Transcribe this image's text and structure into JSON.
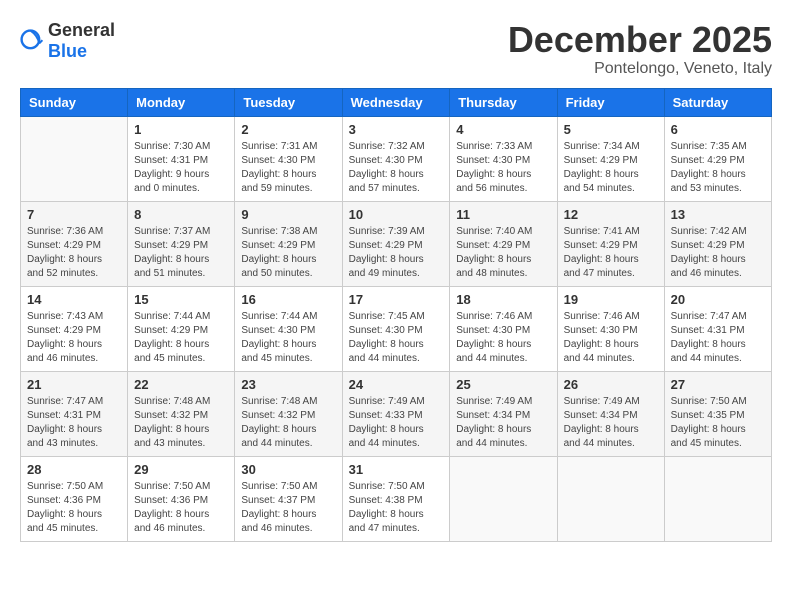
{
  "header": {
    "logo_general": "General",
    "logo_blue": "Blue",
    "month": "December 2025",
    "location": "Pontelongo, Veneto, Italy"
  },
  "weekdays": [
    "Sunday",
    "Monday",
    "Tuesday",
    "Wednesday",
    "Thursday",
    "Friday",
    "Saturday"
  ],
  "weeks": [
    [
      {
        "day": "",
        "info": ""
      },
      {
        "day": "1",
        "info": "Sunrise: 7:30 AM\nSunset: 4:31 PM\nDaylight: 9 hours\nand 0 minutes."
      },
      {
        "day": "2",
        "info": "Sunrise: 7:31 AM\nSunset: 4:30 PM\nDaylight: 8 hours\nand 59 minutes."
      },
      {
        "day": "3",
        "info": "Sunrise: 7:32 AM\nSunset: 4:30 PM\nDaylight: 8 hours\nand 57 minutes."
      },
      {
        "day": "4",
        "info": "Sunrise: 7:33 AM\nSunset: 4:30 PM\nDaylight: 8 hours\nand 56 minutes."
      },
      {
        "day": "5",
        "info": "Sunrise: 7:34 AM\nSunset: 4:29 PM\nDaylight: 8 hours\nand 54 minutes."
      },
      {
        "day": "6",
        "info": "Sunrise: 7:35 AM\nSunset: 4:29 PM\nDaylight: 8 hours\nand 53 minutes."
      }
    ],
    [
      {
        "day": "7",
        "info": "Sunrise: 7:36 AM\nSunset: 4:29 PM\nDaylight: 8 hours\nand 52 minutes."
      },
      {
        "day": "8",
        "info": "Sunrise: 7:37 AM\nSunset: 4:29 PM\nDaylight: 8 hours\nand 51 minutes."
      },
      {
        "day": "9",
        "info": "Sunrise: 7:38 AM\nSunset: 4:29 PM\nDaylight: 8 hours\nand 50 minutes."
      },
      {
        "day": "10",
        "info": "Sunrise: 7:39 AM\nSunset: 4:29 PM\nDaylight: 8 hours\nand 49 minutes."
      },
      {
        "day": "11",
        "info": "Sunrise: 7:40 AM\nSunset: 4:29 PM\nDaylight: 8 hours\nand 48 minutes."
      },
      {
        "day": "12",
        "info": "Sunrise: 7:41 AM\nSunset: 4:29 PM\nDaylight: 8 hours\nand 47 minutes."
      },
      {
        "day": "13",
        "info": "Sunrise: 7:42 AM\nSunset: 4:29 PM\nDaylight: 8 hours\nand 46 minutes."
      }
    ],
    [
      {
        "day": "14",
        "info": "Sunrise: 7:43 AM\nSunset: 4:29 PM\nDaylight: 8 hours\nand 46 minutes."
      },
      {
        "day": "15",
        "info": "Sunrise: 7:44 AM\nSunset: 4:29 PM\nDaylight: 8 hours\nand 45 minutes."
      },
      {
        "day": "16",
        "info": "Sunrise: 7:44 AM\nSunset: 4:30 PM\nDaylight: 8 hours\nand 45 minutes."
      },
      {
        "day": "17",
        "info": "Sunrise: 7:45 AM\nSunset: 4:30 PM\nDaylight: 8 hours\nand 44 minutes."
      },
      {
        "day": "18",
        "info": "Sunrise: 7:46 AM\nSunset: 4:30 PM\nDaylight: 8 hours\nand 44 minutes."
      },
      {
        "day": "19",
        "info": "Sunrise: 7:46 AM\nSunset: 4:30 PM\nDaylight: 8 hours\nand 44 minutes."
      },
      {
        "day": "20",
        "info": "Sunrise: 7:47 AM\nSunset: 4:31 PM\nDaylight: 8 hours\nand 44 minutes."
      }
    ],
    [
      {
        "day": "21",
        "info": "Sunrise: 7:47 AM\nSunset: 4:31 PM\nDaylight: 8 hours\nand 43 minutes."
      },
      {
        "day": "22",
        "info": "Sunrise: 7:48 AM\nSunset: 4:32 PM\nDaylight: 8 hours\nand 43 minutes."
      },
      {
        "day": "23",
        "info": "Sunrise: 7:48 AM\nSunset: 4:32 PM\nDaylight: 8 hours\nand 44 minutes."
      },
      {
        "day": "24",
        "info": "Sunrise: 7:49 AM\nSunset: 4:33 PM\nDaylight: 8 hours\nand 44 minutes."
      },
      {
        "day": "25",
        "info": "Sunrise: 7:49 AM\nSunset: 4:34 PM\nDaylight: 8 hours\nand 44 minutes."
      },
      {
        "day": "26",
        "info": "Sunrise: 7:49 AM\nSunset: 4:34 PM\nDaylight: 8 hours\nand 44 minutes."
      },
      {
        "day": "27",
        "info": "Sunrise: 7:50 AM\nSunset: 4:35 PM\nDaylight: 8 hours\nand 45 minutes."
      }
    ],
    [
      {
        "day": "28",
        "info": "Sunrise: 7:50 AM\nSunset: 4:36 PM\nDaylight: 8 hours\nand 45 minutes."
      },
      {
        "day": "29",
        "info": "Sunrise: 7:50 AM\nSunset: 4:36 PM\nDaylight: 8 hours\nand 46 minutes."
      },
      {
        "day": "30",
        "info": "Sunrise: 7:50 AM\nSunset: 4:37 PM\nDaylight: 8 hours\nand 46 minutes."
      },
      {
        "day": "31",
        "info": "Sunrise: 7:50 AM\nSunset: 4:38 PM\nDaylight: 8 hours\nand 47 minutes."
      },
      {
        "day": "",
        "info": ""
      },
      {
        "day": "",
        "info": ""
      },
      {
        "day": "",
        "info": ""
      }
    ]
  ]
}
